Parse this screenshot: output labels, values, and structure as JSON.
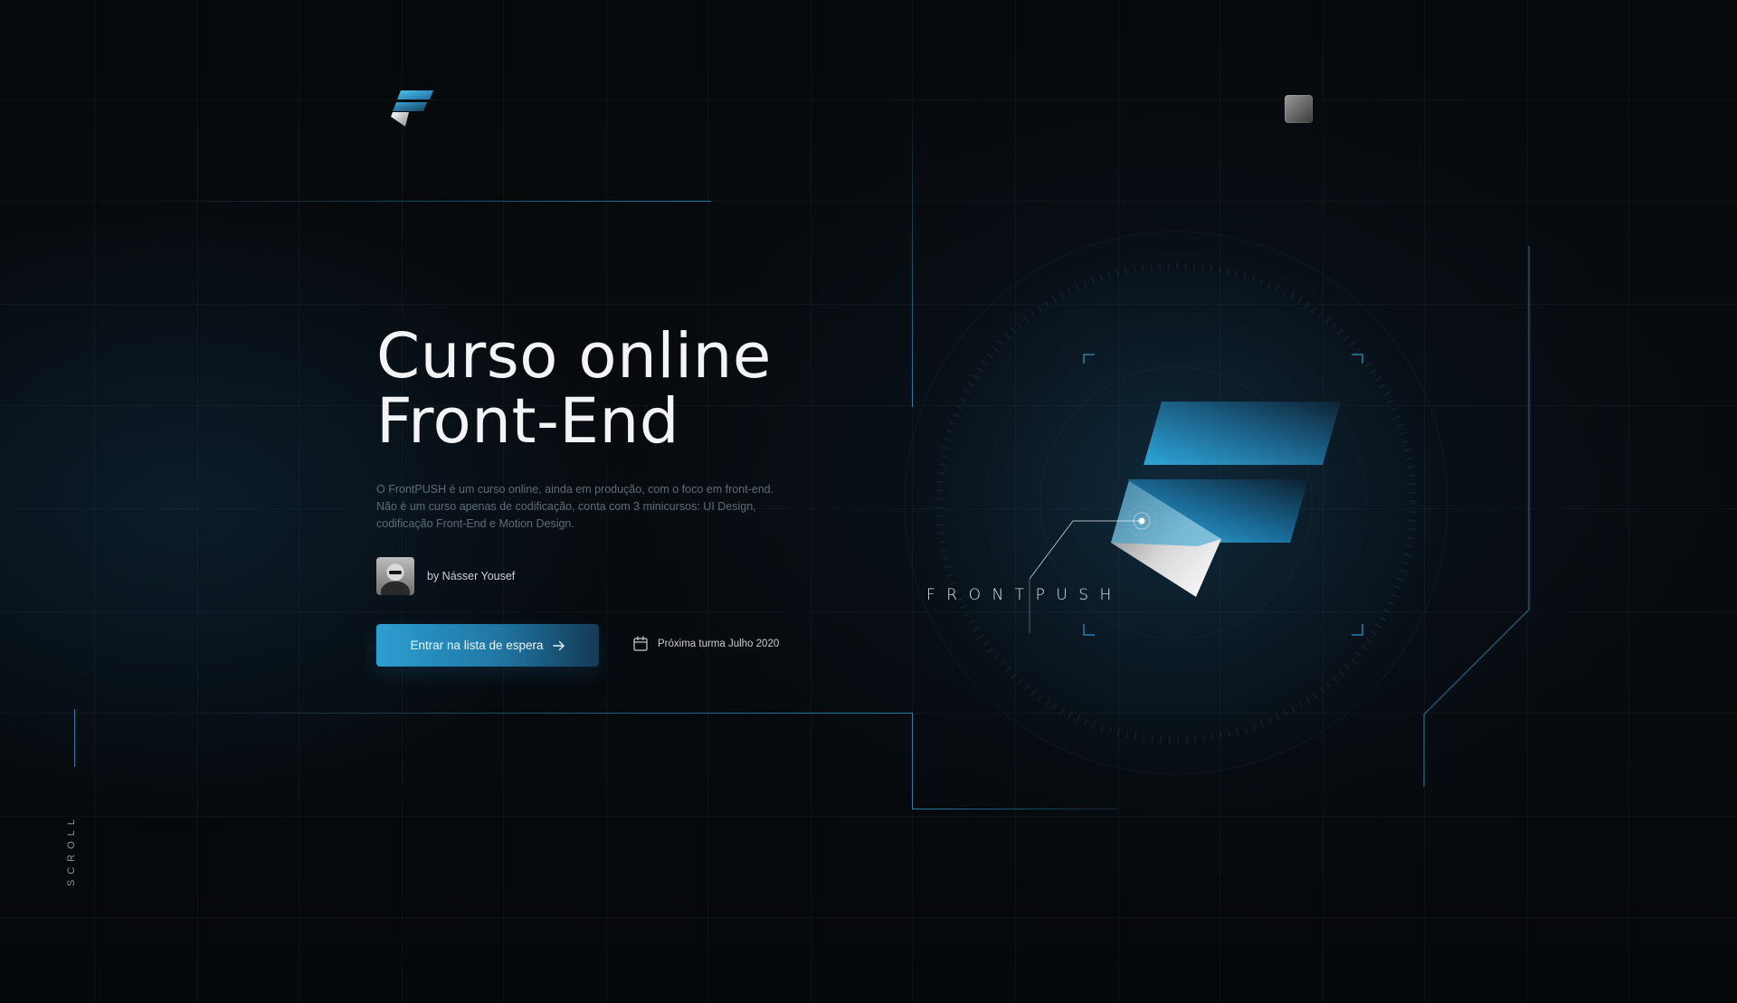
{
  "header": {
    "logo_icon": "frontpush-logo-icon",
    "menu_icon": "menu-square-icon"
  },
  "hero": {
    "title_line1": "Curso online",
    "title_line2": "Front-End",
    "description_lines": [
      "O FrontPUSH é um curso online, ainda em produção, com o foco em front-end.",
      "Não é um curso apenas de codificação, conta com 3 minicursos: UI Design,",
      "codificação Front-End e Motion Design."
    ],
    "author": "by Násser Yousef",
    "cta_label": "Entrar na lista de espera",
    "cta_icon": "arrow-right-icon",
    "next_class_icon": "calendar-icon",
    "next_class_text": "Próxima turma Julho 2020"
  },
  "art": {
    "brand_word": "FRONTPUSH"
  },
  "side": {
    "scroll_label": "SCROLL"
  },
  "colors": {
    "accent": "#2a9fd1",
    "accent_dark": "#14405c",
    "background": "#05080b",
    "text_primary": "#f2f4f6",
    "text_muted": "#5e6c78"
  }
}
